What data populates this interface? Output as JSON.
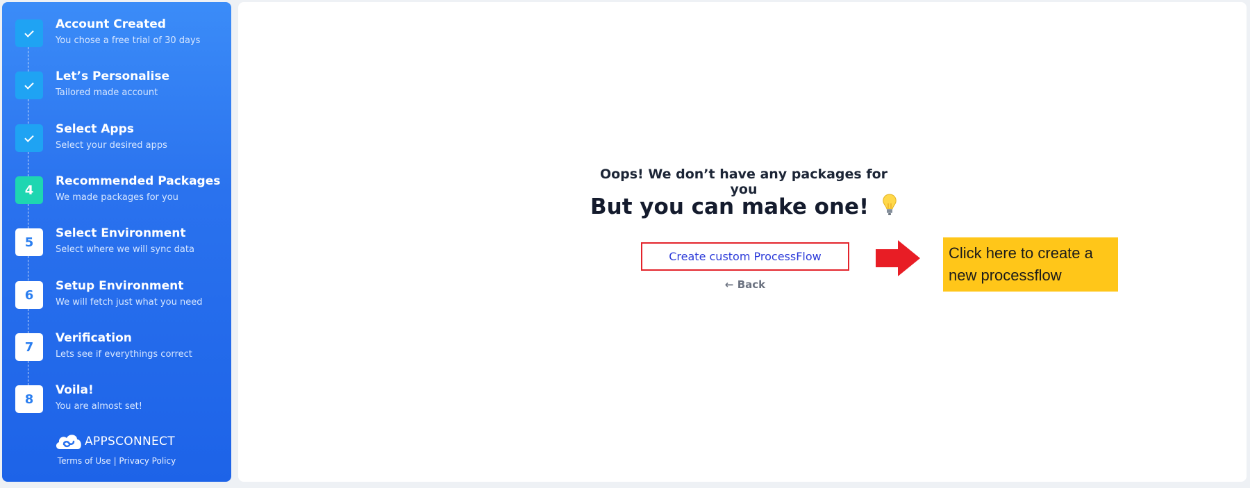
{
  "sidebar": {
    "steps": [
      {
        "number": "",
        "status": "done",
        "title": "Account Created",
        "subtitle": "You chose a free trial of 30 days"
      },
      {
        "number": "",
        "status": "done",
        "title": "Let’s Personalise",
        "subtitle": "Tailored made account"
      },
      {
        "number": "",
        "status": "done",
        "title": "Select Apps",
        "subtitle": "Select your desired apps"
      },
      {
        "number": "4",
        "status": "current",
        "title": "Recommended Packages",
        "subtitle": "We made packages for you"
      },
      {
        "number": "5",
        "status": "todo",
        "title": "Select Environment",
        "subtitle": "Select where we will sync data"
      },
      {
        "number": "6",
        "status": "todo",
        "title": "Setup Environment",
        "subtitle": "We will fetch just what you need"
      },
      {
        "number": "7",
        "status": "todo",
        "title": "Verification",
        "subtitle": "Lets see if everythings correct"
      },
      {
        "number": "8",
        "status": "todo",
        "title": "Voila!",
        "subtitle": "You are almost set!"
      }
    ],
    "logo_text": "APPSCONNECT",
    "footer": {
      "terms": "Terms of Use",
      "separator": " | ",
      "privacy": "Privacy Policy"
    }
  },
  "main": {
    "headline": "Oops! We don’t have any packages for you",
    "subheadline": "But you can make one!",
    "create_button": "Create custom ProcessFlow",
    "back_arrow": "←",
    "back_label": "Back",
    "callout_text": "Click here to create a new processflow"
  },
  "colors": {
    "sidebar_gradient_top": "#3b8cf8",
    "sidebar_gradient_bottom": "#1d63e8",
    "step_done": "#1fa3f3",
    "step_current": "#1ed6b1",
    "button_border": "#e3232b",
    "button_text": "#2b3ad9",
    "callout_bg": "#ffc619",
    "arrow": "#e81d25"
  },
  "icons": {
    "step_done": "check-icon",
    "back": "arrow-left-icon",
    "headline_emoji": "lightbulb-icon",
    "annotation": "arrow-right-icon",
    "logo": "cloud-logo-icon"
  }
}
